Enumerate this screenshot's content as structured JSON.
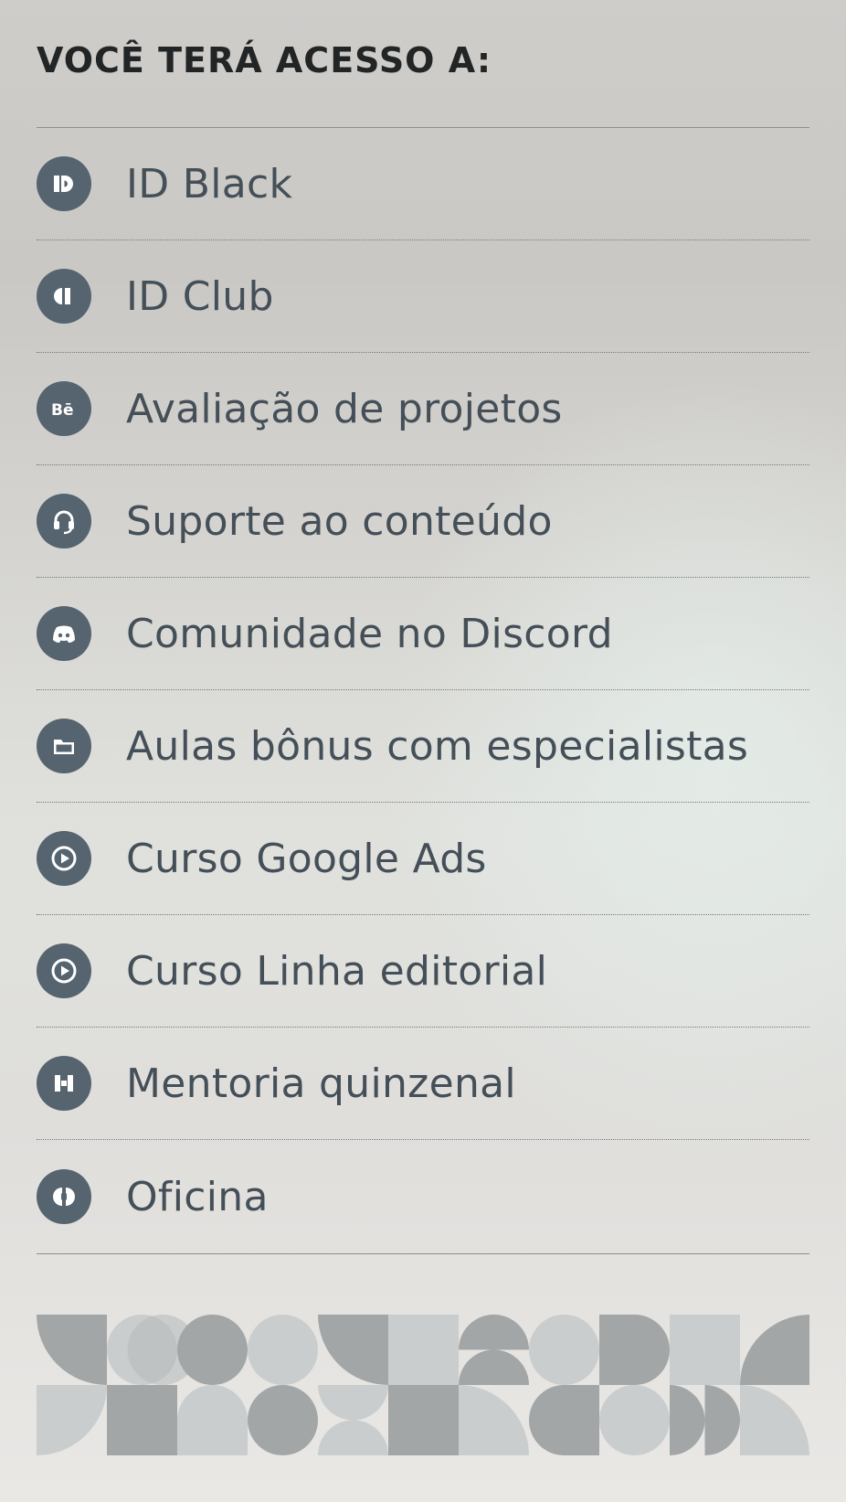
{
  "heading": "VOCÊ TERÁ ACESSO A:",
  "benefits": [
    {
      "label": "ID Black",
      "icon": "id-black-logo-icon"
    },
    {
      "label": "ID Club",
      "icon": "id-club-logo-icon"
    },
    {
      "label": "Avaliação de projetos",
      "icon": "behance-icon"
    },
    {
      "label": "Suporte ao conteúdo",
      "icon": "headset-icon"
    },
    {
      "label": "Comunidade no Discord",
      "icon": "discord-icon"
    },
    {
      "label": "Aulas bônus com especialistas",
      "icon": "folder-icon"
    },
    {
      "label": "Curso Google Ads",
      "icon": "play-icon"
    },
    {
      "label": "Curso Linha editorial",
      "icon": "play-icon"
    },
    {
      "label": "Mentoria quinzenal",
      "icon": "mentoring-logo-icon"
    },
    {
      "label": "Oficina",
      "icon": "workshop-logo-icon"
    }
  ],
  "colors": {
    "icon_background": "#56646f",
    "icon_foreground": "#ffffff",
    "label_text": "#444f58",
    "heading_text": "#222526",
    "pattern_dark": "#a3a6a7",
    "pattern_light": "#c9cdcd"
  }
}
